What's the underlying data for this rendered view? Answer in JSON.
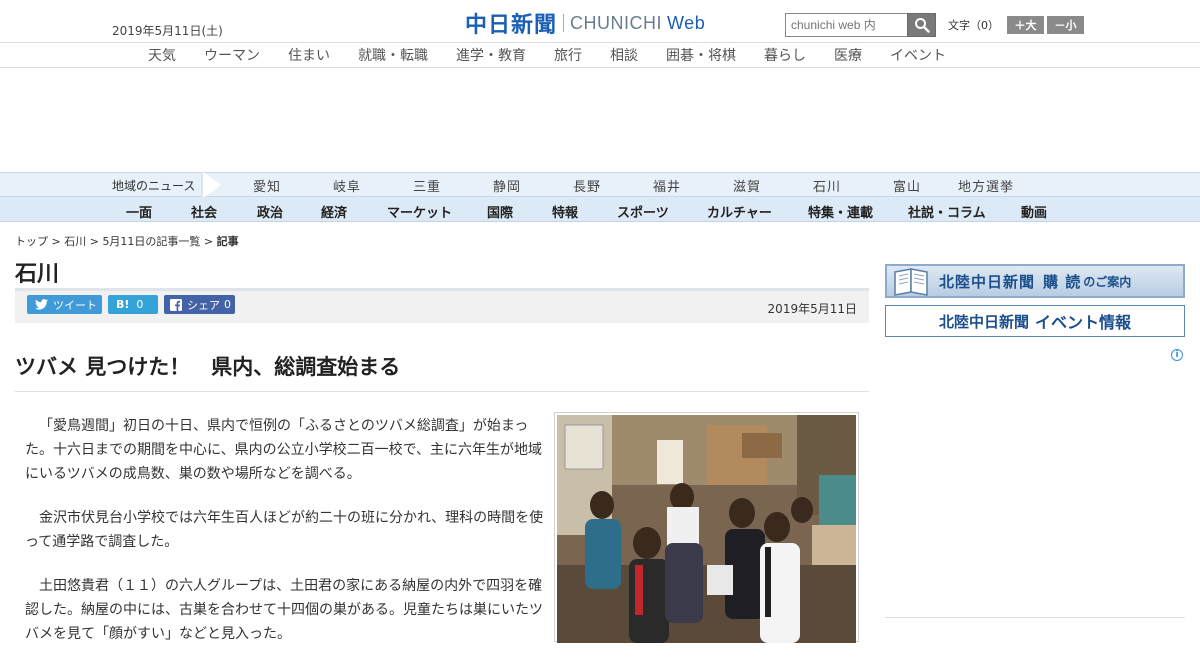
{
  "header": {
    "date": "2019年5月11日(土)",
    "logo_jp": "中日新聞",
    "logo_en": "CHUNICHI",
    "logo_web": "Web",
    "search_placeholder": "chunichi web 内",
    "font_label": "文字（0）",
    "font_bigger": "＋大",
    "font_smaller": "－小"
  },
  "menu1": [
    "天気",
    "ウーマン",
    "住まい",
    "就職・転職",
    "進学・教育",
    "旅行",
    "相談",
    "囲碁・将棋",
    "暮らし",
    "医療",
    "イベント"
  ],
  "region_bar": {
    "title": "地域のニュース",
    "items": [
      "愛知",
      "岐阜",
      "三重",
      "静岡",
      "長野",
      "福井",
      "滋賀",
      "石川",
      "富山",
      "地方選挙"
    ]
  },
  "category_bar": [
    "一面",
    "社会",
    "政治",
    "経済",
    "マーケット",
    "国際",
    "特報",
    "スポーツ",
    "カルチャー",
    "特集・連載",
    "社説・コラム",
    "動画"
  ],
  "breadcrumb": {
    "items": [
      "トップ",
      "石川",
      "5月11日の記事一覧"
    ],
    "separator": " > ",
    "current": "記事"
  },
  "section_title": "石川",
  "share": {
    "tweet_label": "ツイート",
    "hatena_label": "B!",
    "hatena_count": "0",
    "facebook_label": "シェア",
    "facebook_count": "0",
    "date": "2019年5月11日"
  },
  "article": {
    "headline": "ツバメ 見つけた！　県内、総調査始まる",
    "paragraphs": [
      "「愛鳥週間」初日の十日、県内で恒例の「ふるさとのツバメ総調査」が始まった。十六日までの期間を中心に、県内の公立小学校二百一校で、主に六年生が地域にいるツバメの成鳥数、巣の数や場所などを調べる。",
      "金沢市伏見台小学校では六年生百人ほどが約二十の班に分かれ、理科の時間を使って通学路で調査した。",
      "土田悠貴君（１１）の六人グループは、土田君の家にある納屋の内外で四羽を確認した。納屋の中には、古巣を合わせて十四個の巣がある。児童たちは巣にいたツバメを見て「顔がすい」などと見入った。"
    ]
  },
  "sidebar": {
    "banner1_title": "北陸中日新聞",
    "banner1_sub1": "購 読",
    "banner1_sub2": "のご案内",
    "banner2_title": "北陸中日新聞",
    "banner2_sub": "イベント情報",
    "ad_info": "i"
  },
  "colors": {
    "brand": "#1a5fb4",
    "region_bar_bg": "#e8f1fa",
    "category_bar_bg": "#dce9f6",
    "twitter": "#3f9ad7",
    "hatena": "#35a3d8",
    "facebook": "#4462a8"
  }
}
